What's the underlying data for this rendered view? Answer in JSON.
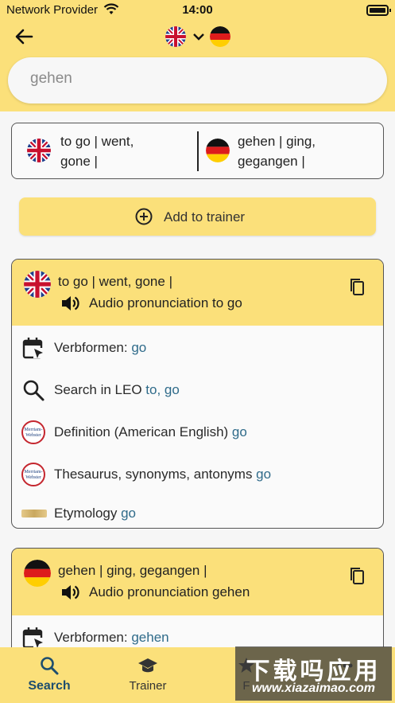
{
  "status_bar": {
    "carrier": "Network Provider",
    "time": "14:00"
  },
  "header": {
    "source_flag": "uk-flag-icon",
    "target_flag": "germany-flag-icon"
  },
  "search": {
    "value": "gehen"
  },
  "result": {
    "en_line1": "to go  | went,",
    "en_line2": "gone |",
    "de_line1": "gehen  | ging,",
    "de_line2": "gegangen |"
  },
  "add_trainer": {
    "label": "Add to trainer"
  },
  "card_en": {
    "title": "to go  | went, gone |",
    "audio": "Audio pronunciation to go",
    "rows": [
      {
        "label": "Verbformen: ",
        "link": "go"
      },
      {
        "label": "Search in LEO ",
        "link": "to, go"
      },
      {
        "label": "Definition (American English) ",
        "link": "go"
      },
      {
        "label": "Thesaurus, synonyms, antonyms ",
        "link": "go"
      },
      {
        "label": "Etymology ",
        "link": "go"
      }
    ],
    "mw_text": "Merriam-Webster"
  },
  "card_de": {
    "title": "gehen  | ging, gegangen |",
    "audio": "Audio pronunciation gehen",
    "rows": [
      {
        "label": "Verbformen: ",
        "link": "gehen"
      }
    ]
  },
  "tabs": [
    {
      "label": "Search",
      "icon": "search-icon"
    },
    {
      "label": "Trainer",
      "icon": "graduation-cap-icon"
    },
    {
      "label": "F",
      "icon": "favorites-icon"
    },
    {
      "label": "",
      "icon": "more-icon"
    }
  ],
  "watermark": {
    "line1": "下载吗应用",
    "line2": "www.xiazaimao.com"
  },
  "colors": {
    "accent": "#fbe07a",
    "link": "#2f6b8a",
    "active_tab": "#1e4e6e",
    "background": "#f6f6f6"
  }
}
